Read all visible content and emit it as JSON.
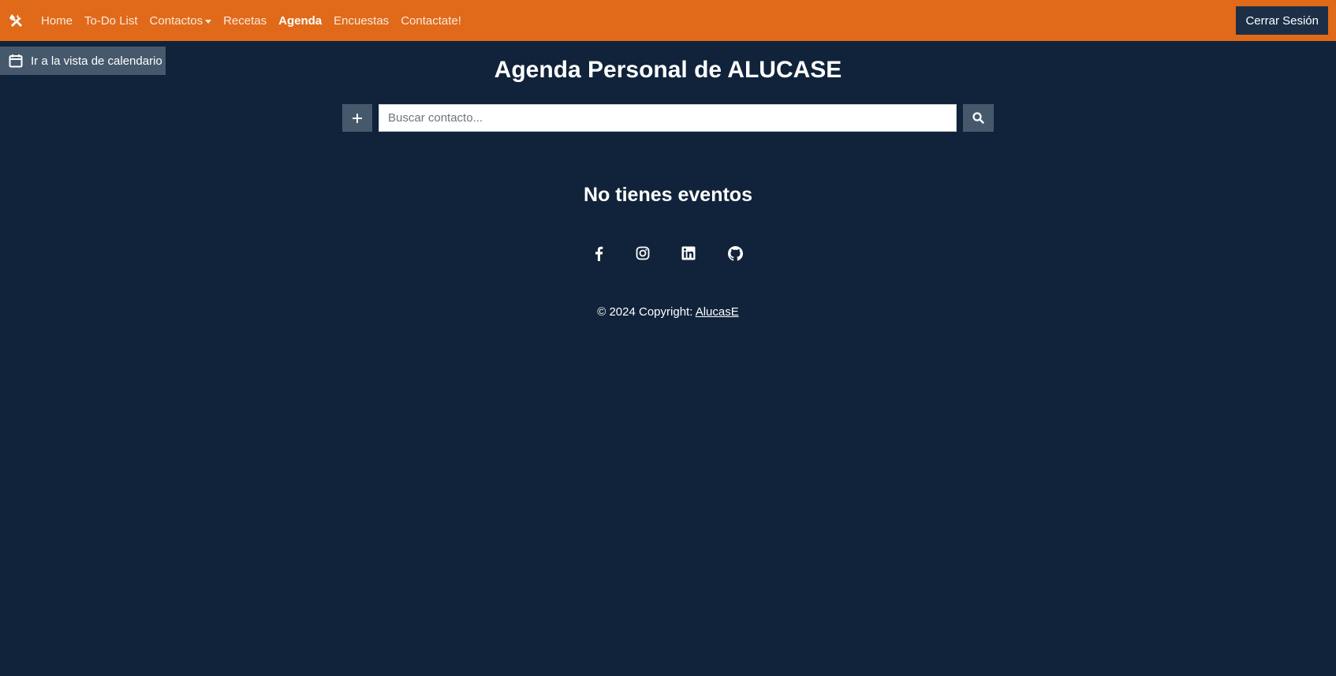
{
  "navbar": {
    "brand_icon": "tools-icon",
    "bg_color": "#e06a19",
    "links": [
      {
        "label": "Home"
      },
      {
        "label": "To-Do List"
      },
      {
        "label": "Contactos"
      },
      {
        "label": "Recetas"
      },
      {
        "label": "Agenda",
        "active": true
      },
      {
        "label": "Encuestas"
      },
      {
        "label": "Contactate!"
      }
    ],
    "logout_label": "Cerrar Sesión"
  },
  "calendar_button": {
    "icon": "calendar-icon",
    "label": "Ir a la vista de calendario"
  },
  "main": {
    "title": "Agenda Personal de ALUCASE",
    "add_icon": "plus-icon",
    "search": {
      "placeholder": "Buscar contacto...",
      "value": ""
    },
    "search_icon": "search-icon",
    "empty_message": "No tienes eventos"
  },
  "footer": {
    "social": [
      "facebook-icon",
      "instagram-icon",
      "linkedin-icon",
      "github-icon"
    ],
    "copyright_text": "© 2024 Copyright: ",
    "copyright_link": "AlucasE"
  },
  "colors": {
    "page_bg": "#10233a",
    "button_bg": "#46586c",
    "logout_bg": "#1c2f47"
  }
}
